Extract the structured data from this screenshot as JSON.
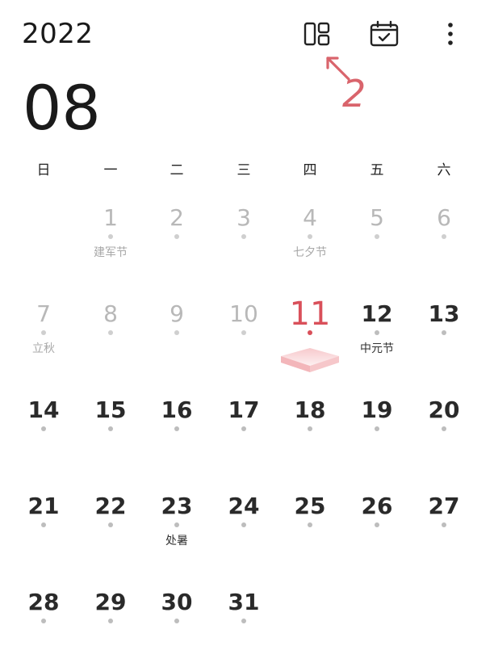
{
  "header": {
    "year": "2022",
    "month": "08",
    "icons": [
      "layout-icon",
      "calendar-today-icon",
      "more-vert-icon"
    ],
    "annotation": "2"
  },
  "weekdays": [
    "日",
    "一",
    "二",
    "三",
    "四",
    "五",
    "六"
  ],
  "colors": {
    "accent": "#d9505a",
    "dim": "#b8b8b8",
    "text": "#2a2a2a"
  },
  "days": [
    {
      "n": "1",
      "label": "建军节",
      "state": "dim"
    },
    {
      "n": "2",
      "label": "",
      "state": "dim"
    },
    {
      "n": "3",
      "label": "",
      "state": "dim"
    },
    {
      "n": "4",
      "label": "七夕节",
      "state": "dim"
    },
    {
      "n": "5",
      "label": "",
      "state": "dim"
    },
    {
      "n": "6",
      "label": "",
      "state": "dim"
    },
    {
      "n": "7",
      "label": "立秋",
      "state": "dim"
    },
    {
      "n": "8",
      "label": "",
      "state": "dim"
    },
    {
      "n": "9",
      "label": "",
      "state": "dim"
    },
    {
      "n": "10",
      "label": "",
      "state": "dim"
    },
    {
      "n": "11",
      "label": "",
      "state": "today"
    },
    {
      "n": "12",
      "label": "中元节",
      "state": ""
    },
    {
      "n": "13",
      "label": "",
      "state": ""
    },
    {
      "n": "14",
      "label": "",
      "state": ""
    },
    {
      "n": "15",
      "label": "",
      "state": ""
    },
    {
      "n": "16",
      "label": "",
      "state": ""
    },
    {
      "n": "17",
      "label": "",
      "state": ""
    },
    {
      "n": "18",
      "label": "",
      "state": ""
    },
    {
      "n": "19",
      "label": "",
      "state": ""
    },
    {
      "n": "20",
      "label": "",
      "state": ""
    },
    {
      "n": "21",
      "label": "",
      "state": ""
    },
    {
      "n": "22",
      "label": "",
      "state": ""
    },
    {
      "n": "23",
      "label": "处暑",
      "state": ""
    },
    {
      "n": "24",
      "label": "",
      "state": ""
    },
    {
      "n": "25",
      "label": "",
      "state": ""
    },
    {
      "n": "26",
      "label": "",
      "state": ""
    },
    {
      "n": "27",
      "label": "",
      "state": ""
    },
    {
      "n": "28",
      "label": "",
      "state": ""
    },
    {
      "n": "29",
      "label": "",
      "state": ""
    },
    {
      "n": "30",
      "label": "",
      "state": ""
    },
    {
      "n": "31",
      "label": "",
      "state": ""
    }
  ]
}
